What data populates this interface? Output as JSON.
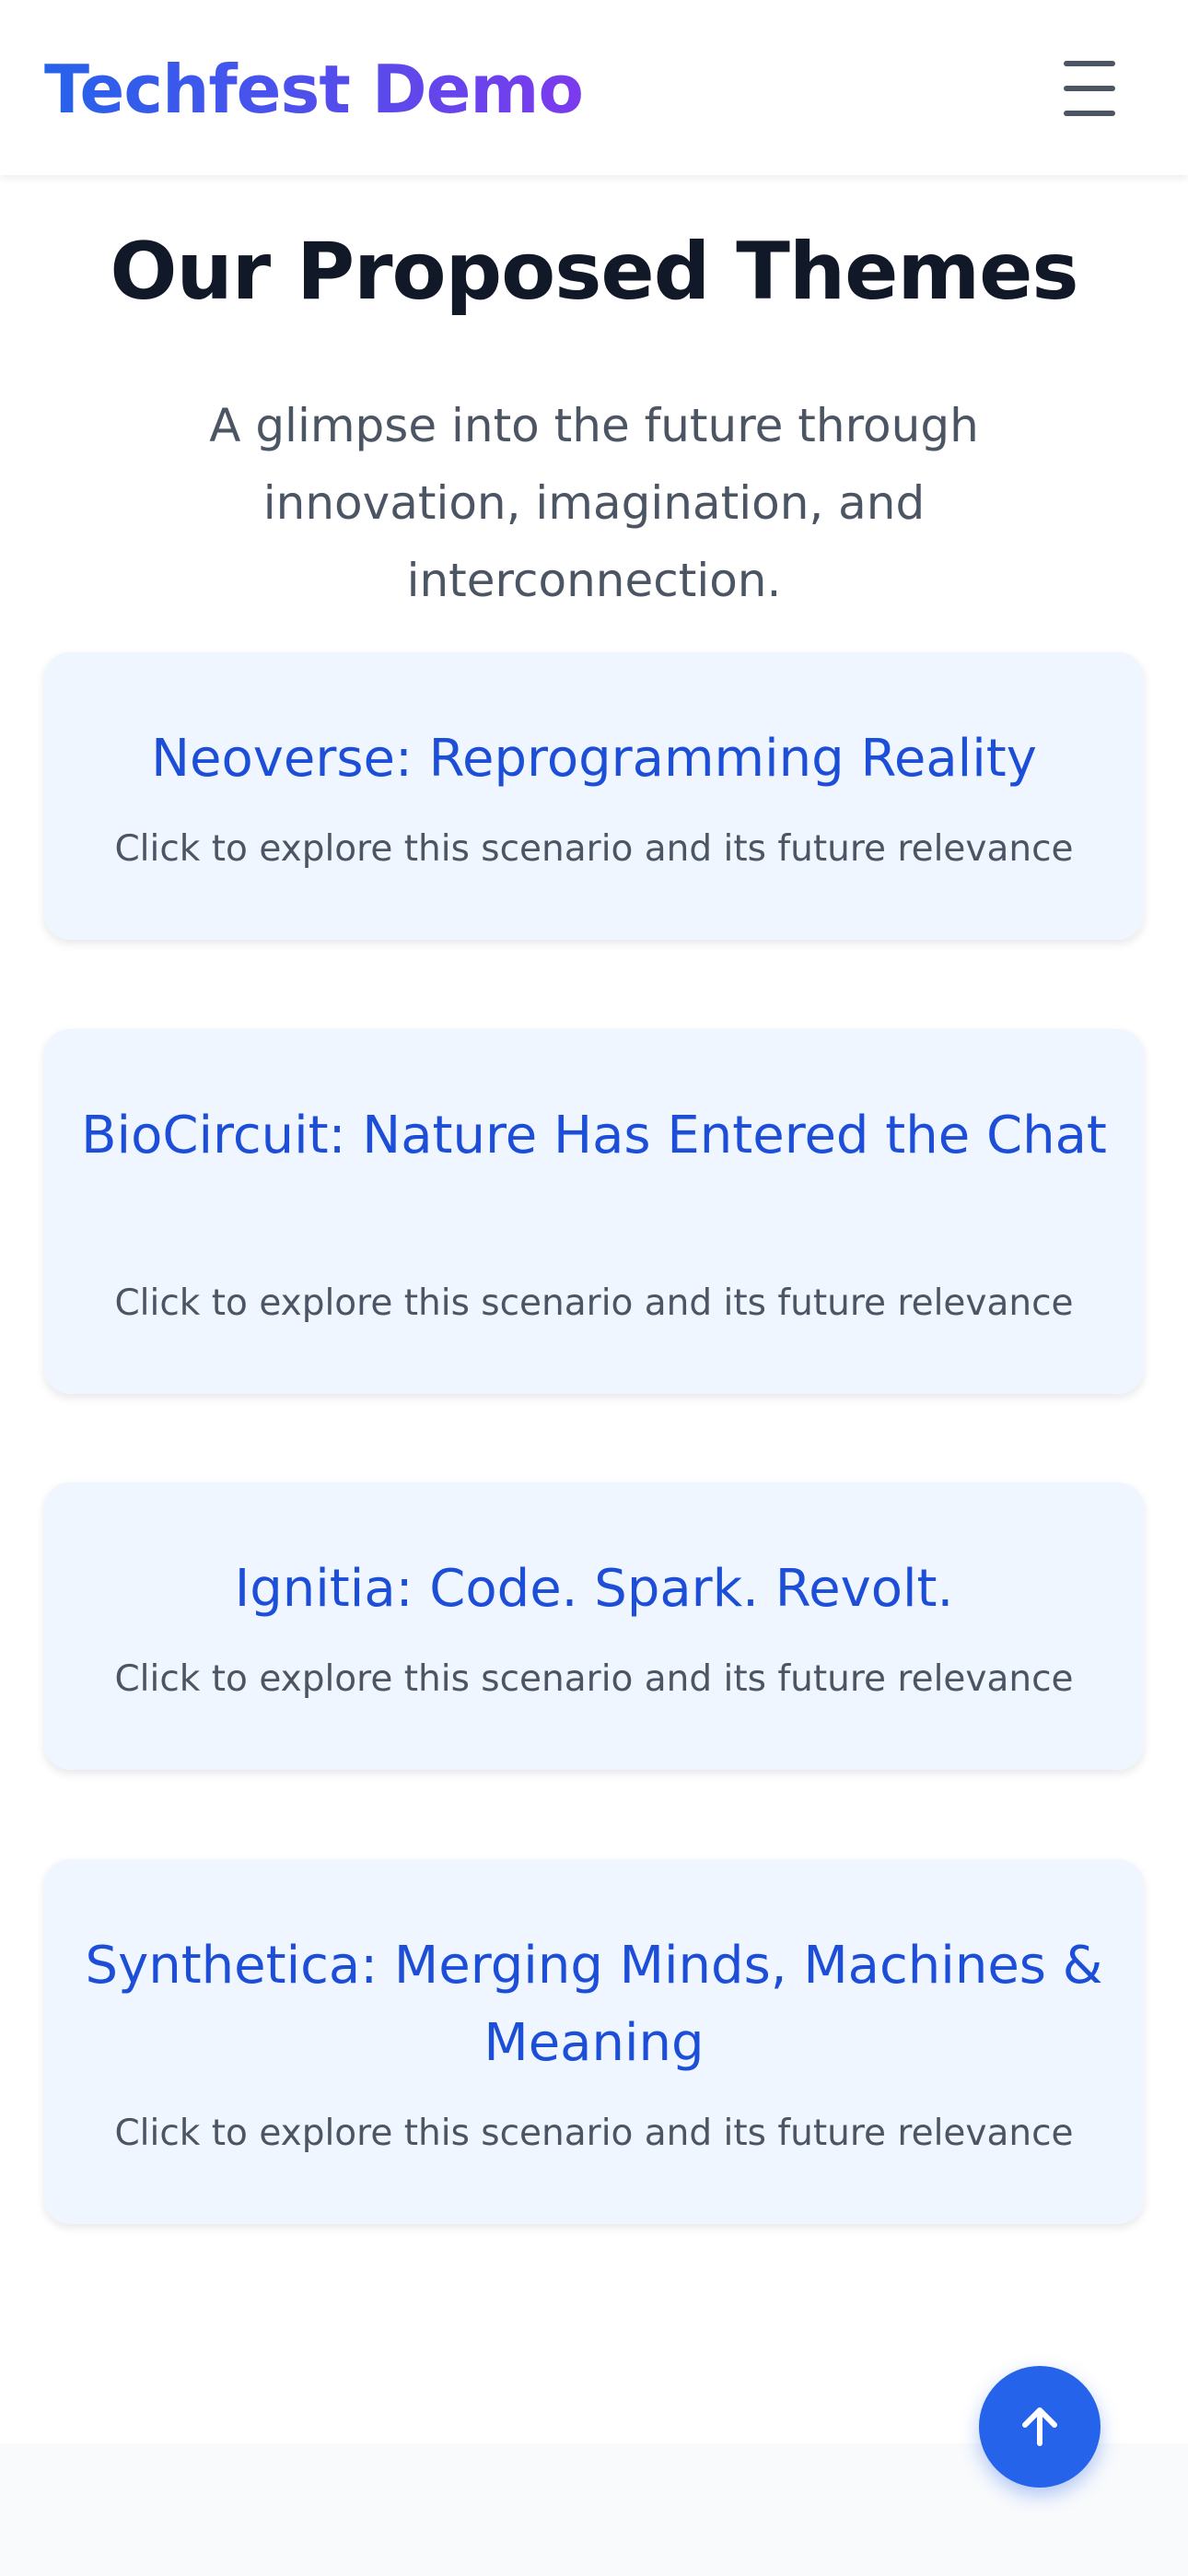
{
  "header": {
    "brand": "Techfest Demo",
    "menu_icon": "hamburger-menu-icon"
  },
  "main": {
    "title": "Our Proposed Themes",
    "subtitle": "A glimpse into the future through innovation, imagination, and interconnection.",
    "themes": [
      {
        "title": "Neoverse: Reprogramming Reality",
        "description": "Click to explore this scenario and its future relevance"
      },
      {
        "title": "BioCircuit: Nature Has Entered the Chat",
        "description": "Click to explore this scenario and its future relevance"
      },
      {
        "title": "Ignitia: Code. Spark. Revolt.",
        "description": "Click to explore this scenario and its future relevance"
      },
      {
        "title": "Synthetica: Merging Minds, Machines & Meaning",
        "description": "Click to explore this scenario and its future relevance"
      }
    ]
  },
  "scroll_top": {
    "icon": "arrow-up-icon"
  },
  "colors": {
    "brand_gradient_start": "#2563eb",
    "brand_gradient_end": "#7c3aed",
    "card_background": "#eff6ff",
    "card_title": "#1d4ed8",
    "accent_button": "#2563eb"
  }
}
